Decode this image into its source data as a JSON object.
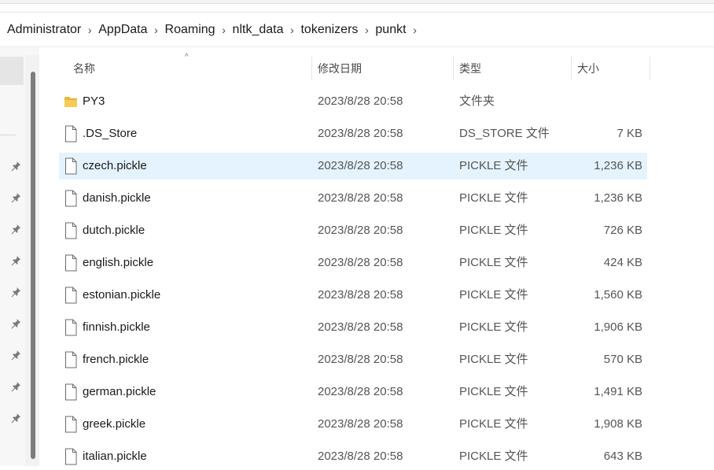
{
  "breadcrumb": [
    "Administrator",
    "AppData",
    "Roaming",
    "nltk_data",
    "tokenizers",
    "punkt"
  ],
  "columns": {
    "name": "名称",
    "date": "修改日期",
    "type": "类型",
    "size": "大小"
  },
  "files": [
    {
      "name": "PY3",
      "date": "2023/8/28 20:58",
      "type": "文件夹",
      "size": "",
      "icon": "folder-icon"
    },
    {
      "name": ".DS_Store",
      "date": "2023/8/28 20:58",
      "type": "DS_STORE 文件",
      "size": "7 KB",
      "icon": "file-icon"
    },
    {
      "name": "czech.pickle",
      "date": "2023/8/28 20:58",
      "type": "PICKLE 文件",
      "size": "1,236 KB",
      "icon": "file-icon",
      "selected": true
    },
    {
      "name": "danish.pickle",
      "date": "2023/8/28 20:58",
      "type": "PICKLE 文件",
      "size": "1,236 KB",
      "icon": "file-icon"
    },
    {
      "name": "dutch.pickle",
      "date": "2023/8/28 20:58",
      "type": "PICKLE 文件",
      "size": "726 KB",
      "icon": "file-icon"
    },
    {
      "name": "english.pickle",
      "date": "2023/8/28 20:58",
      "type": "PICKLE 文件",
      "size": "424 KB",
      "icon": "file-icon"
    },
    {
      "name": "estonian.pickle",
      "date": "2023/8/28 20:58",
      "type": "PICKLE 文件",
      "size": "1,560 KB",
      "icon": "file-icon"
    },
    {
      "name": "finnish.pickle",
      "date": "2023/8/28 20:58",
      "type": "PICKLE 文件",
      "size": "1,906 KB",
      "icon": "file-icon"
    },
    {
      "name": "french.pickle",
      "date": "2023/8/28 20:58",
      "type": "PICKLE 文件",
      "size": "570 KB",
      "icon": "file-icon"
    },
    {
      "name": "german.pickle",
      "date": "2023/8/28 20:58",
      "type": "PICKLE 文件",
      "size": "1,491 KB",
      "icon": "file-icon"
    },
    {
      "name": "greek.pickle",
      "date": "2023/8/28 20:58",
      "type": "PICKLE 文件",
      "size": "1,908 KB",
      "icon": "file-icon"
    },
    {
      "name": "italian.pickle",
      "date": "2023/8/28 20:58",
      "type": "PICKLE 文件",
      "size": "643 KB",
      "icon": "file-icon"
    }
  ],
  "colors": {
    "selection": "#e5f3ff",
    "folder": "#f0c14b"
  }
}
